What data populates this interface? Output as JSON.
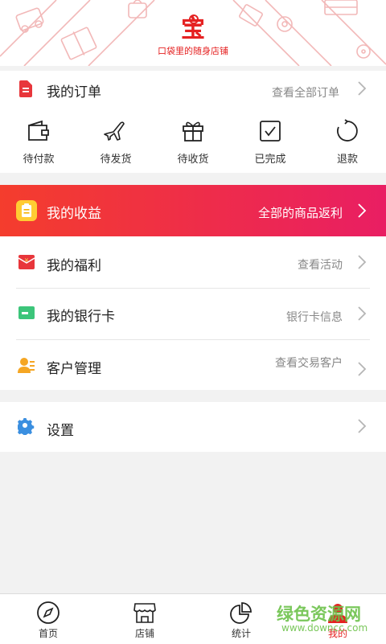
{
  "brand": {
    "logo_char": "宝",
    "tagline": "口袋里的随身店铺"
  },
  "orders": {
    "title": "我的订单",
    "view_all": "查看全部订单",
    "items": [
      {
        "label": "待付款",
        "icon": "wallet-icon"
      },
      {
        "label": "待发货",
        "icon": "airplane-icon"
      },
      {
        "label": "待收货",
        "icon": "gift-icon"
      },
      {
        "label": "已完成",
        "icon": "checkbox-icon"
      },
      {
        "label": "退款",
        "icon": "refresh-icon"
      }
    ]
  },
  "earnings": {
    "title": "我的收益",
    "right": "全部的商品返利",
    "gradient_start": "#f43d2d",
    "gradient_end": "#e91e63"
  },
  "menu": [
    {
      "title": "我的福利",
      "right": "查看活动",
      "icon": "red-envelope-icon",
      "color": "#e8363b"
    },
    {
      "title": "我的银行卡",
      "right": "银行卡信息",
      "icon": "bank-card-icon",
      "color": "#3cc57a"
    },
    {
      "title": "客户管理",
      "right": "查看交易客户",
      "icon": "customer-icon",
      "color": "#f5a623"
    }
  ],
  "settings": {
    "title": "设置",
    "icon": "gear-icon",
    "color": "#3b8fe0"
  },
  "tabbar": [
    {
      "label": "首页",
      "icon": "compass-icon"
    },
    {
      "label": "店铺",
      "icon": "store-icon"
    },
    {
      "label": "统计",
      "icon": "pie-chart-icon"
    },
    {
      "label": "我的",
      "icon": "person-icon",
      "active_color": "#e52222"
    }
  ],
  "watermark": {
    "text": "绿色资源网",
    "url": "www.downcc.com"
  }
}
